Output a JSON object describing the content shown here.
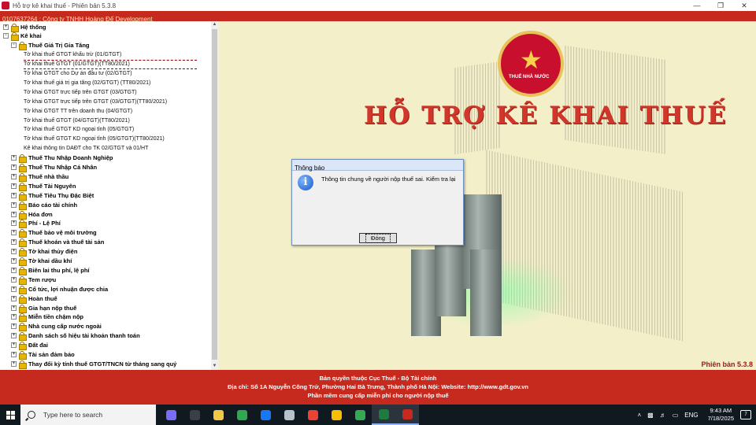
{
  "window": {
    "title": "Hỗ trợ kê khai thuế - Phiên bản 5.3.8"
  },
  "company_bar": {
    "text": "0107637264 : Công ty TNHH Hoàng Đế Development"
  },
  "tree": [
    {
      "label": "Hệ thống",
      "bold": true,
      "level": 0,
      "expander": "+"
    },
    {
      "label": "Kê khai",
      "bold": true,
      "level": 0,
      "expander": "-"
    },
    {
      "label": "Thuế Giá Trị Gia Tăng",
      "bold": true,
      "level": 1,
      "expander": "-"
    },
    {
      "label": "Tờ khai thuế GTGT khấu trừ (01/GTGT)",
      "level": 2
    },
    {
      "label": "Tờ khai thuế GTGT (01/GTGT)(TT80/2021)",
      "level": 2,
      "selected": true
    },
    {
      "label": "Tờ khai GTGT cho Dự án đầu tư (02/GTGT)",
      "level": 2
    },
    {
      "label": "Tờ khai thuế giá trị gia tăng (02/GTGT) (TT80/2021)",
      "level": 2
    },
    {
      "label": "Tờ khai GTGT trực tiếp trên GTGT (03/GTGT)",
      "level": 2
    },
    {
      "label": "Tờ khai GTGT trực tiếp trên GTGT (03/GTGT)(TT80/2021)",
      "level": 2
    },
    {
      "label": "Tờ khai GTGT TT trên doanh thu (04/GTGT)",
      "level": 2
    },
    {
      "label": "Tờ khai thuế GTGT (04/GTGT)(TT80/2021)",
      "level": 2
    },
    {
      "label": "Tờ khai thuế GTGT KD ngoại tỉnh (05/GTGT)",
      "level": 2
    },
    {
      "label": "Tờ khai thuế GTGT KD ngoại tỉnh (05/GTGT)(TT80/2021)",
      "level": 2
    },
    {
      "label": "Kê khai thông tin DAĐT cho TK 02/GTGT và 01/HT",
      "level": 2
    },
    {
      "label": "Thuế Thu Nhập Doanh Nghiệp",
      "bold": true,
      "level": 1,
      "expander": "+"
    },
    {
      "label": "Thuế Thu Nhập Cá Nhân",
      "bold": true,
      "level": 1,
      "expander": "+"
    },
    {
      "label": "Thuế nhà thầu",
      "bold": true,
      "level": 1,
      "expander": "+"
    },
    {
      "label": "Thuế Tài Nguyên",
      "bold": true,
      "level": 1,
      "expander": "+"
    },
    {
      "label": "Thuế Tiêu Thụ Đặc Biệt",
      "bold": true,
      "level": 1,
      "expander": "+"
    },
    {
      "label": "Báo cáo tài chính",
      "bold": true,
      "level": 1,
      "expander": "+"
    },
    {
      "label": "Hóa đơn",
      "bold": true,
      "level": 1,
      "expander": "+"
    },
    {
      "label": "Phí - Lệ Phí",
      "bold": true,
      "level": 1,
      "expander": "+"
    },
    {
      "label": "Thuế bảo vệ môi trường",
      "bold": true,
      "level": 1,
      "expander": "+"
    },
    {
      "label": "Thuế khoán và thuế tài sản",
      "bold": true,
      "level": 1,
      "expander": "+"
    },
    {
      "label": "Tờ khai thủy điện",
      "bold": true,
      "level": 1,
      "expander": "+"
    },
    {
      "label": "Tờ khai dầu khí",
      "bold": true,
      "level": 1,
      "expander": "+"
    },
    {
      "label": "Biên lai thu phí, lệ phí",
      "bold": true,
      "level": 1,
      "expander": "+"
    },
    {
      "label": "Tem rượu",
      "bold": true,
      "level": 1,
      "expander": "+"
    },
    {
      "label": "Cổ tức, lợi nhuận được chia",
      "bold": true,
      "level": 1,
      "expander": "+"
    },
    {
      "label": "Hoàn thuế",
      "bold": true,
      "level": 1,
      "expander": "+"
    },
    {
      "label": "Gia hạn nộp thuế",
      "bold": true,
      "level": 1,
      "expander": "+"
    },
    {
      "label": "Miễn tiền chậm nộp",
      "bold": true,
      "level": 1,
      "expander": "+"
    },
    {
      "label": "Nhà cung cấp nước ngoài",
      "bold": true,
      "level": 1,
      "expander": "+"
    },
    {
      "label": "Danh sách số hiệu tài khoản thanh toán",
      "bold": true,
      "level": 1,
      "expander": "+"
    },
    {
      "label": "Đất đai",
      "bold": true,
      "level": 1,
      "expander": "+"
    },
    {
      "label": "Tài sản đảm bảo",
      "bold": true,
      "level": 1,
      "expander": "+"
    },
    {
      "label": "Thay đổi kỳ tính thuế GTGT/TNCN từ tháng sang quý",
      "bold": true,
      "level": 1,
      "expander": "+"
    }
  ],
  "banner": {
    "emblem_text": "THUẾ NHÀ NƯỚC",
    "title": "HỖ TRỢ KÊ KHAI THUẾ",
    "version": "Phiên bản 5.3.8"
  },
  "dialog": {
    "title": "Thông báo",
    "message": "Thông tin chung về người nộp thuế sai. Kiểm tra lại",
    "ok_label": "Đóng"
  },
  "footer": {
    "line1": "Bản quyền thuộc Cục Thuế - Bộ Tài chính",
    "line2": "Địa chỉ: Số 1A Nguyễn Công Trứ, Phường Hai Bà Trưng, Thành phố Hà Nội: Website: http://www.gdt.gov.vn",
    "line3": "Phần mềm cung cấp miễn phí cho người nộp thuế"
  },
  "taskbar": {
    "search_placeholder": "Type here to search",
    "apps": [
      {
        "name": "copilot-icon",
        "color": "#7b6cf6"
      },
      {
        "name": "task-view-icon",
        "color": "#3a3f47"
      },
      {
        "name": "file-explorer-icon",
        "color": "#f2c744"
      },
      {
        "name": "zalo-icon",
        "color": "#2fa84f"
      },
      {
        "name": "facebook-icon",
        "color": "#1877f2"
      },
      {
        "name": "messenger-icon",
        "color": "#b8c2cc"
      },
      {
        "name": "chrome-icon",
        "color": "#ea4335"
      },
      {
        "name": "chrome-profile-icon",
        "color": "#fbbc05"
      },
      {
        "name": "colorful-app-icon",
        "color": "#34a853"
      },
      {
        "name": "excel-icon",
        "color": "#1f7a3e"
      },
      {
        "name": "tax-app-icon",
        "color": "#c62a1f"
      }
    ],
    "language": "ENG",
    "time": "9:43 AM",
    "date": "7/18/2025",
    "notifications": "7"
  }
}
